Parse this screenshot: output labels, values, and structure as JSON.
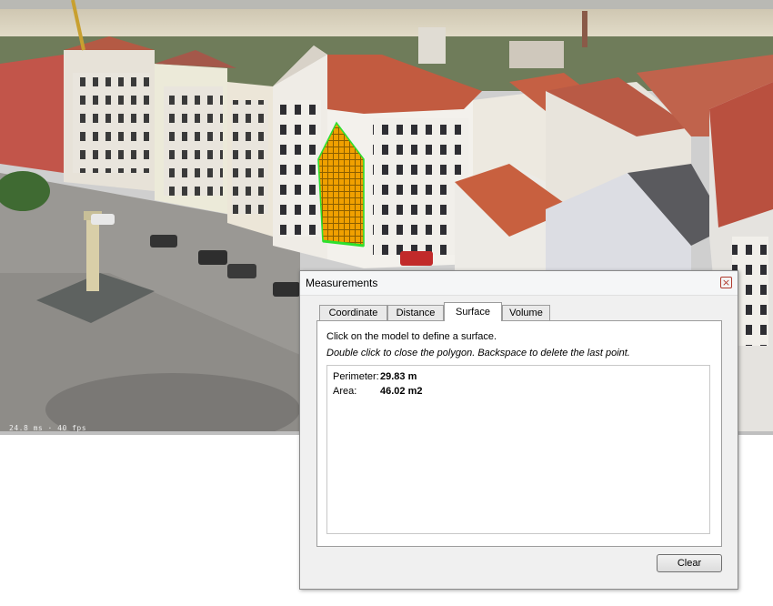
{
  "viewport": {
    "status_text": "24.8 ms · 40 fps",
    "colors": {
      "sky": "#eae3cf",
      "roof": "#c9644a",
      "facade": "#e8e4dc",
      "plaza": "#9c9a96",
      "polygon": "#f0a000",
      "polygon_edge": "#2ee02e"
    }
  },
  "dialog": {
    "title": "Measurements",
    "close_icon": "close-icon",
    "tabs": [
      {
        "label": "Coordinate",
        "active": false
      },
      {
        "label": "Distance",
        "active": false
      },
      {
        "label": "Surface",
        "active": true
      },
      {
        "label": "Volume",
        "active": false
      }
    ],
    "instruction": "Click on the model to define a surface.",
    "hint": "Double click to close the polygon. Backspace to delete the last point.",
    "results": {
      "perimeter_label": "Perimeter:",
      "perimeter_value": "29.83 m",
      "area_label": "Area:",
      "area_value": "46.02 m2"
    },
    "clear_label": "Clear"
  }
}
